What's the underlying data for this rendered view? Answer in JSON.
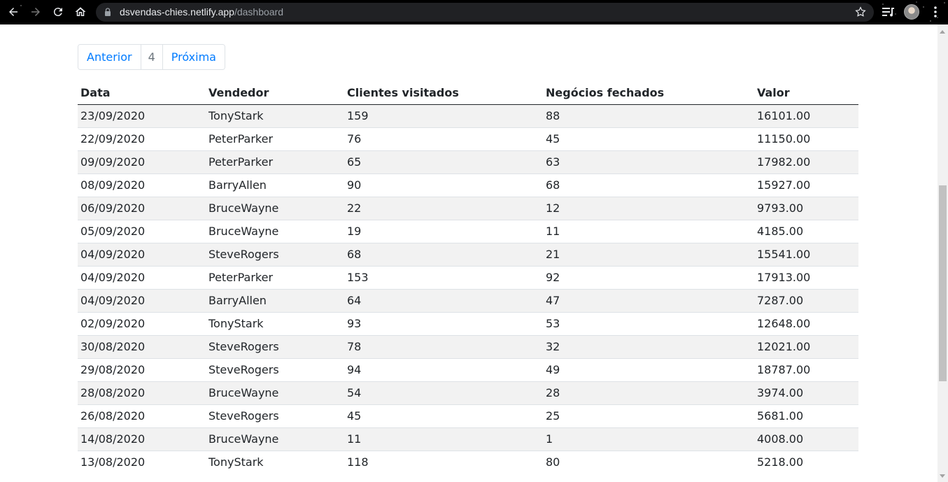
{
  "browser": {
    "url_host": "dsvendas-chies.netlify.app",
    "url_path": "/dashboard"
  },
  "pagination": {
    "prev_label": "Anterior",
    "current_page": "4",
    "next_label": "Próxima"
  },
  "table": {
    "headers": [
      "Data",
      "Vendedor",
      "Clientes visitados",
      "Negócios fechados",
      "Valor"
    ],
    "rows": [
      [
        "23/09/2020",
        "TonyStark",
        "159",
        "88",
        "16101.00"
      ],
      [
        "22/09/2020",
        "PeterParker",
        "76",
        "45",
        "11150.00"
      ],
      [
        "09/09/2020",
        "PeterParker",
        "65",
        "63",
        "17982.00"
      ],
      [
        "08/09/2020",
        "BarryAllen",
        "90",
        "68",
        "15927.00"
      ],
      [
        "06/09/2020",
        "BruceWayne",
        "22",
        "12",
        "9793.00"
      ],
      [
        "05/09/2020",
        "BruceWayne",
        "19",
        "11",
        "4185.00"
      ],
      [
        "04/09/2020",
        "SteveRogers",
        "68",
        "21",
        "15541.00"
      ],
      [
        "04/09/2020",
        "PeterParker",
        "153",
        "92",
        "17913.00"
      ],
      [
        "04/09/2020",
        "BarryAllen",
        "64",
        "47",
        "7287.00"
      ],
      [
        "02/09/2020",
        "TonyStark",
        "93",
        "53",
        "12648.00"
      ],
      [
        "30/08/2020",
        "SteveRogers",
        "78",
        "32",
        "12021.00"
      ],
      [
        "29/08/2020",
        "SteveRogers",
        "94",
        "49",
        "18787.00"
      ],
      [
        "28/08/2020",
        "BruceWayne",
        "54",
        "28",
        "3974.00"
      ],
      [
        "26/08/2020",
        "SteveRogers",
        "45",
        "25",
        "5681.00"
      ],
      [
        "14/08/2020",
        "BruceWayne",
        "11",
        "1",
        "4008.00"
      ],
      [
        "13/08/2020",
        "TonyStark",
        "118",
        "80",
        "5218.00"
      ]
    ]
  },
  "colors": {
    "link": "#007bff",
    "stripe": "#f2f2f2",
    "chrome_bg": "#000000"
  }
}
